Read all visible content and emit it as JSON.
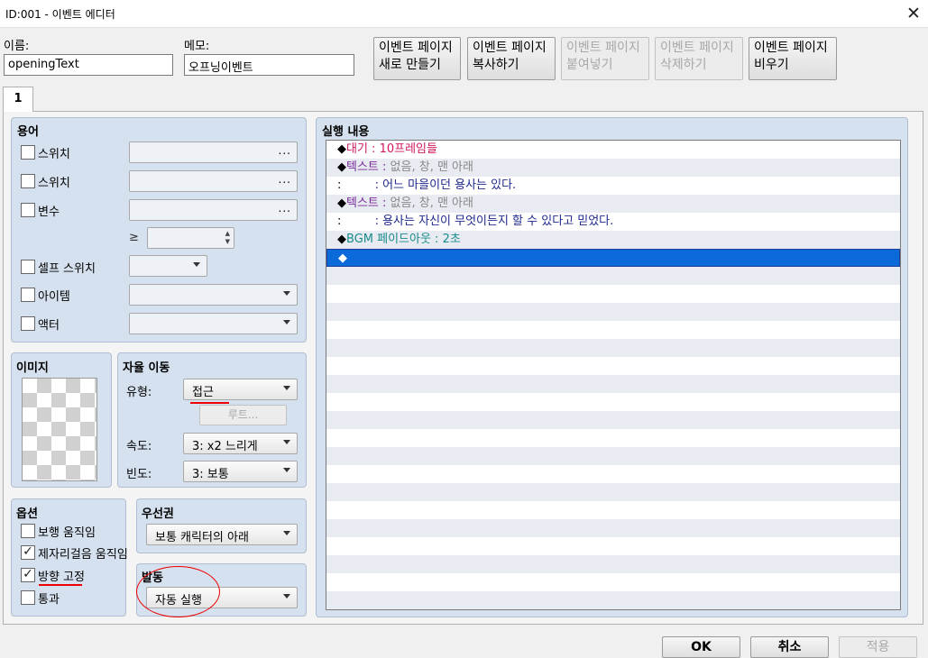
{
  "window": {
    "title": "ID:001 - 이벤트 에디터",
    "close_glyph": "✕"
  },
  "name_field": {
    "label": "이름:",
    "value": "openingText"
  },
  "memo_field": {
    "label": "메모:",
    "value": "오프닝이벤트"
  },
  "page_buttons": [
    {
      "line1": "이벤트 페이지",
      "line2": "새로 만들기",
      "enabled": true
    },
    {
      "line1": "이벤트 페이지",
      "line2": "복사하기",
      "enabled": true
    },
    {
      "line1": "이벤트 페이지",
      "line2": "붙여넣기",
      "enabled": false
    },
    {
      "line1": "이벤트 페이지",
      "line2": "삭제하기",
      "enabled": false
    },
    {
      "line1": "이벤트 페이지",
      "line2": "비우기",
      "enabled": true
    }
  ],
  "tab": {
    "label": "1"
  },
  "conditions": {
    "title": "용어",
    "switch1": "스위치",
    "switch2": "스위치",
    "variable": "변수",
    "dots": "...",
    "ge": "≥",
    "self_switch": "셀프 스위치",
    "item": "아이템",
    "actor": "액터"
  },
  "image": {
    "title": "이미지"
  },
  "autonomous": {
    "title": "자율 이동",
    "type_label": "유형:",
    "type_value": "접근",
    "route_button": "루트...",
    "speed_label": "속도:",
    "speed_value": "3: x2 느리게",
    "freq_label": "빈도:",
    "freq_value": "3: 보통"
  },
  "options": {
    "title": "옵션",
    "walking": {
      "label": "보행 움직임",
      "checked": false
    },
    "stepping": {
      "label": "제자리걸음 움직임",
      "checked": true
    },
    "direction_fix": {
      "label": "방향 고정",
      "checked": true
    },
    "through": {
      "label": "통과",
      "checked": false
    },
    "check_glyph": "✓"
  },
  "priority": {
    "title": "우선권",
    "value": "보통 캐릭터의 아래"
  },
  "trigger": {
    "title": "발동",
    "value": "자동 실행"
  },
  "contents": {
    "title": "실행 내용",
    "rows": [
      {
        "prefix": "◆",
        "cmd": "대기",
        "sep": " : ",
        "body": "10프레임들",
        "cmd_color": "#d0195e",
        "body_color": "#d0195e"
      },
      {
        "prefix": "◆",
        "cmd": "텍스트",
        "sep": " : ",
        "body": "없음, 창, 맨 아래",
        "cmd_color": "#7a2a9a",
        "body_color": "#888888"
      },
      {
        "prefix": ":",
        "cmd": "",
        "sep": "         : ",
        "body": "어느 마을이던 용사는 있다.",
        "cmd_color": "#1e2a8f",
        "body_color": "#1e2a8f"
      },
      {
        "prefix": "◆",
        "cmd": "텍스트",
        "sep": " : ",
        "body": "없음, 창, 맨 아래",
        "cmd_color": "#7a2a9a",
        "body_color": "#888888"
      },
      {
        "prefix": ":",
        "cmd": "",
        "sep": "         : ",
        "body": "용사는 자신이 무엇이든지 할 수 있다고 믿었다.",
        "cmd_color": "#1e2a8f",
        "body_color": "#1e2a8f"
      },
      {
        "prefix": "◆",
        "cmd": "BGM 페이드아웃",
        "sep": " : ",
        "body": "2초",
        "cmd_color": "#1a8a8a",
        "body_color": "#1a8a8a"
      },
      {
        "prefix": "◆",
        "cmd": "",
        "sep": "",
        "body": "",
        "cmd_color": "#ffffff",
        "body_color": "#ffffff",
        "selected": true
      }
    ]
  },
  "bottom_buttons": {
    "ok": "OK",
    "cancel": "취소",
    "apply": "적용"
  }
}
